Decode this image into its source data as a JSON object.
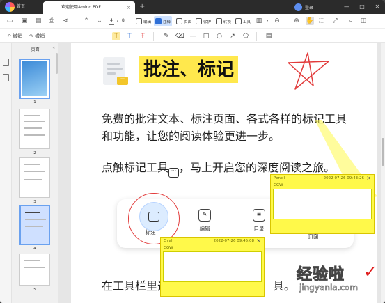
{
  "titlebar": {
    "home_tab": "首页",
    "doc_tab": "欢迎使用Amind PDF",
    "close_tab": "×",
    "add_tab": "+",
    "login": "登录",
    "minimize": "—",
    "maximize": "□",
    "close": "✕"
  },
  "toolbar": {
    "page_current": "4",
    "page_sep": "/",
    "page_total": "8",
    "tabs": [
      "编辑",
      "注释",
      "页面",
      "保护",
      "转换",
      "工具"
    ],
    "active_tab": "注释",
    "undo": "撤销",
    "redo": "撤销"
  },
  "thumbpanel": {
    "title": "页面",
    "collapse": "«",
    "pages": [
      "1",
      "2",
      "3",
      "4",
      "5"
    ],
    "selected_page": "4"
  },
  "page": {
    "heading": "批注、标记",
    "para1": "免费的批注文本、标注页面、各式各样的标记工具和功能，让您的阅读体验更进一步。",
    "para2_pre": "点触标记工具",
    "para2_post": "，马上开启您的深度阅读之旅。",
    "para3_a": "在工具栏里选",
    "para3_b": "具。",
    "card_items": [
      "标注",
      "编辑",
      "目录",
      "页面"
    ]
  },
  "notes": [
    {
      "type": "Pencil",
      "time": "2022-07-26 09:43:26",
      "author": "CGW"
    },
    {
      "type": "Oval",
      "time": "2022-07-26 09:45:08",
      "author": "CGW"
    }
  ],
  "watermark": {
    "title": "经验啦",
    "check": "✓",
    "sub": "jingyanla.com"
  },
  "colors": {
    "accent": "#2f6fd6",
    "highlight": "#ffe84d",
    "note": "#fff94a",
    "annotation_red": "#e23b3b"
  }
}
